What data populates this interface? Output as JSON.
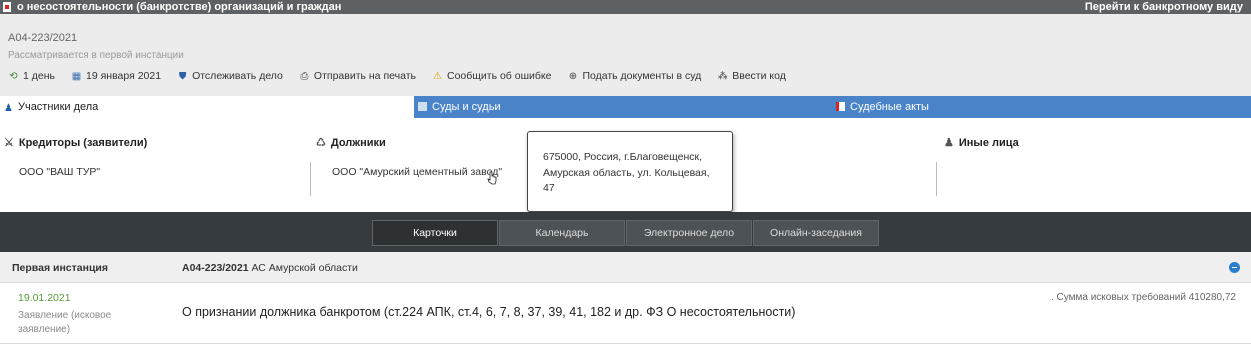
{
  "topbar": {
    "title": "о несостоятельности (банкротстве) организаций и граждан",
    "right_link": "Перейти к банкротному виду"
  },
  "case": {
    "number": "А04-223/2021",
    "status": "Рассматривается в первой инстанции"
  },
  "toolbar": [
    {
      "icon": "refresh-icon",
      "label": "1 день"
    },
    {
      "icon": "calendar-icon",
      "label": "19 января 2021"
    },
    {
      "icon": "shield-icon",
      "label": "Отслеживать дело"
    },
    {
      "icon": "printer-icon",
      "label": "Отправить на печать"
    },
    {
      "icon": "warning-icon",
      "label": "Сообщить об ошибке"
    },
    {
      "icon": "plus-circle-icon",
      "label": "Подать документы в суд"
    },
    {
      "icon": "code-icon",
      "label": "Ввести код"
    }
  ],
  "tabs": [
    {
      "label": "Участники дела",
      "icon": "person-icon"
    },
    {
      "label": "Суды и судьи",
      "icon": "court-icon"
    },
    {
      "label": "Судебные акты",
      "icon": "document-icon"
    }
  ],
  "participants": {
    "creditors": {
      "header": "Кредиторы (заявители)",
      "value": "ООО \"ВАШ ТУР\""
    },
    "debtors": {
      "header": "Должники",
      "value": "ООО \"Амурский цементный завод\""
    },
    "others": {
      "header": "Иные лица"
    }
  },
  "tooltip": {
    "text": "675000, Россия, г.Благовещенск, Амурская область, ул. Кольцевая, 47"
  },
  "view_tabs": [
    "Карточки",
    "Календарь",
    "Электронное дело",
    "Онлайн-заседания"
  ],
  "instance": {
    "label": "Первая инстанция",
    "case_number": "А04-223/2021",
    "court": "АС Амурской области"
  },
  "entry": {
    "date": "19.01.2021",
    "type": "Заявление (исковое заявление)",
    "text": "О признании должника банкротом (ст.224 АПК, ст.4, 6, 7, 8, 37, 39, 41, 182 и др. ФЗ О несостоятельности)",
    "sum": ". Сумма исковых требований 410280,72"
  },
  "colors": {
    "topbar": "#5e6163",
    "tab_blue": "#4a83c8",
    "viewbar": "#363b3f",
    "date_green": "#5a9c3a",
    "accent_blue": "#2b7dd0"
  }
}
